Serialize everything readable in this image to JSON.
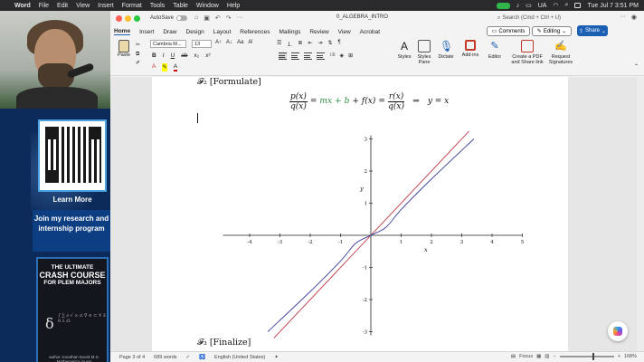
{
  "menubar": {
    "app": "Word",
    "items": [
      "File",
      "Edit",
      "View",
      "Insert",
      "Format",
      "Tools",
      "Table",
      "Window",
      "Help"
    ],
    "input_source": "UA",
    "clock": "Tue Jul 7  3:51 PM"
  },
  "left_panel": {
    "learn_more": "Learn More",
    "join_text": "Join my research and internship program",
    "book_title_1": "THE ULTIMATE",
    "book_title_2": "CRASH COURSE",
    "book_title_3": "FOR PLEM MAJORS",
    "book_author": "author Jonathan David M.S. Mathematics (pure)"
  },
  "titlebar": {
    "autosave_label": "AutoSave",
    "doc_title": "0_ALGEBRA_INTRO",
    "search_placeholder": "Search (Cmd + Ctrl + U)"
  },
  "tabs": [
    "Home",
    "Insert",
    "Draw",
    "Design",
    "Layout",
    "References",
    "Mailings",
    "Review",
    "View",
    "Acrobat"
  ],
  "header_buttons": {
    "comments": "Comments",
    "editing": "Editing",
    "share": "Share"
  },
  "ribbon": {
    "paste": "Paste",
    "font_name": "Cambria M...",
    "font_size": "13",
    "styles": "Styles",
    "styles_pane": "Styles Pane",
    "dictate": "Dictate",
    "addins": "Add-ins",
    "editor": "Editor",
    "create_pdf": "Create a PDF and Share link",
    "request_sig": "Request Signatures"
  },
  "document": {
    "heading1": "𝓕₂ [Formulate]",
    "heading2": "𝓕₃ [Finalize]",
    "eq_p": "p(x)",
    "eq_q": "q(x)",
    "eq_eq1": "=",
    "eq_mx": "mx",
    "eq_plus1": "+",
    "eq_b": "b",
    "eq_plus2": "+",
    "eq_f": "f(x)",
    "eq_eq2": "=",
    "eq_r": "r(x)",
    "eq_q2": "q(x)",
    "eq_arrow": "⇒",
    "eq_result": "y = x"
  },
  "chart_data": {
    "type": "line",
    "xlabel": "x",
    "ylabel": "y",
    "xlim": [
      -5,
      5
    ],
    "ylim": [
      -3,
      3
    ],
    "xticks": [
      -4,
      -3,
      -2,
      -1,
      1,
      2,
      3,
      4,
      5
    ],
    "yticks": [
      -3,
      -2,
      -1,
      1,
      2,
      3
    ],
    "series": [
      {
        "color": "#c0394b",
        "x": [
          -3.2,
          3.5
        ],
        "y": [
          -3.2,
          3.5
        ]
      },
      {
        "color": "#3b3f9a",
        "x": [
          -3.4,
          -2,
          -1,
          -0.5,
          0,
          0.5,
          1,
          2,
          3.4
        ],
        "y": [
          -3.0,
          -1.75,
          -0.8,
          -0.25,
          0,
          0.25,
          0.8,
          1.75,
          3.0
        ]
      }
    ]
  },
  "statusbar": {
    "page": "Page 3 of 4",
    "words": "689 words",
    "language": "English (United States)",
    "focus": "Focus",
    "zoom": "168%",
    "zoom_fraction": 0.62
  },
  "colors": {
    "accent": "#1a5fb4",
    "green_term": "#2e8b3e"
  }
}
